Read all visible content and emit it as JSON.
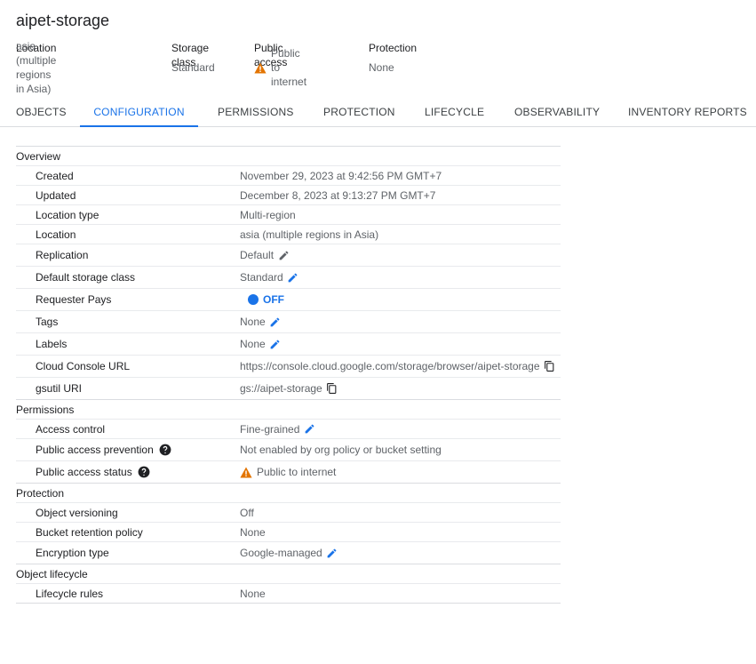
{
  "bucket": {
    "name": "aipet-storage"
  },
  "summary": [
    {
      "label": "Location",
      "value": "asia (multiple regions in Asia)"
    },
    {
      "label": "Storage class",
      "value": "Standard"
    },
    {
      "label": "Public access",
      "value": "Public to internet",
      "icon": "warning-icon"
    },
    {
      "label": "Protection",
      "value": "None"
    }
  ],
  "tabs": [
    {
      "label": "OBJECTS"
    },
    {
      "label": "CONFIGURATION",
      "active": true
    },
    {
      "label": "PERMISSIONS"
    },
    {
      "label": "PROTECTION"
    },
    {
      "label": "LIFECYCLE"
    },
    {
      "label": "OBSERVABILITY"
    },
    {
      "label": "INVENTORY REPORTS"
    }
  ],
  "sections": {
    "overview": {
      "title": "Overview",
      "rows": {
        "created": {
          "label": "Created",
          "value": "November 29, 2023 at 9:42:56 PM GMT+7"
        },
        "updated": {
          "label": "Updated",
          "value": "December 8, 2023 at 9:13:27 PM GMT+7"
        },
        "location_type": {
          "label": "Location type",
          "value": "Multi-region"
        },
        "location": {
          "label": "Location",
          "value": "asia (multiple regions in Asia)"
        },
        "replication": {
          "label": "Replication",
          "value": "Default"
        },
        "default_storage_class": {
          "label": "Default storage class",
          "value": "Standard"
        },
        "requester_pays": {
          "label": "Requester Pays",
          "value": "OFF"
        },
        "tags": {
          "label": "Tags",
          "value": "None"
        },
        "labels": {
          "label": "Labels",
          "value": "None"
        },
        "console_url": {
          "label": "Cloud Console URL",
          "value": "https://console.cloud.google.com/storage/browser/aipet-storage"
        },
        "gsutil_uri": {
          "label": "gsutil URI",
          "value": "gs://aipet-storage"
        }
      }
    },
    "permissions": {
      "title": "Permissions",
      "rows": {
        "access_control": {
          "label": "Access control",
          "value": "Fine-grained"
        },
        "public_access_prevention": {
          "label": "Public access prevention",
          "value": "Not enabled by org policy or bucket setting"
        },
        "public_access_status": {
          "label": "Public access status",
          "value": "Public to internet"
        }
      }
    },
    "protection": {
      "title": "Protection",
      "rows": {
        "object_versioning": {
          "label": "Object versioning",
          "value": "Off"
        },
        "bucket_retention_policy": {
          "label": "Bucket retention policy",
          "value": "None"
        },
        "encryption_type": {
          "label": "Encryption type",
          "value": "Google-managed"
        }
      }
    },
    "lifecycle": {
      "title": "Object lifecycle",
      "rows": {
        "lifecycle_rules": {
          "label": "Lifecycle rules",
          "value": "None"
        }
      }
    }
  },
  "colors": {
    "accent": "#1a73e8",
    "warning": "#e37400",
    "text": "#202124",
    "muted": "#5f6368"
  }
}
